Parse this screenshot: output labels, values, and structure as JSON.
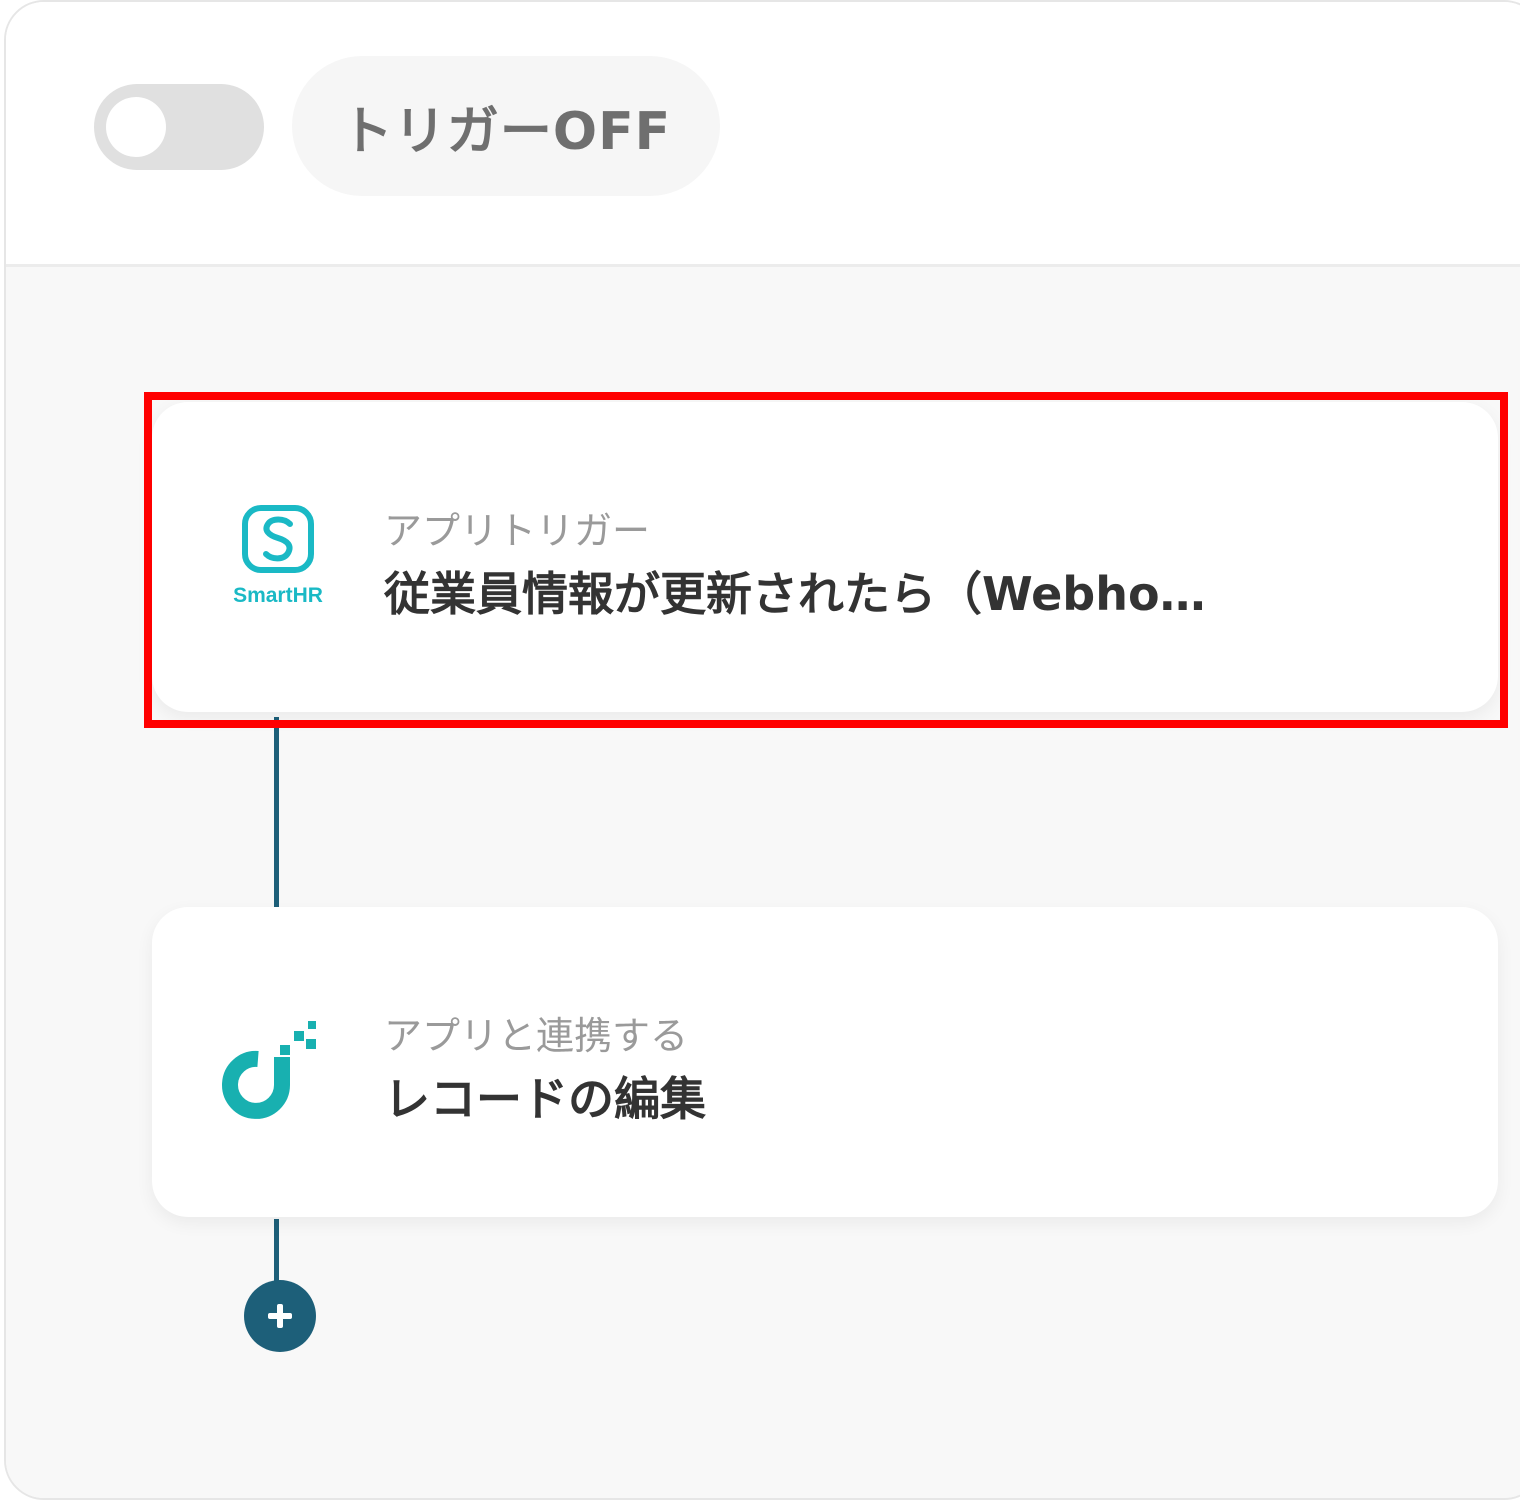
{
  "header": {
    "trigger_toggle_state": "off",
    "trigger_label": "トリガーOFF"
  },
  "flow": {
    "steps": [
      {
        "icon": "smarthr-logo-icon",
        "logo_text": "SmartHR",
        "subtitle": "アプリトリガー",
        "title": "従業員情報が更新されたら（Webho…",
        "highlighted": true
      },
      {
        "icon": "app-connect-logo-icon",
        "subtitle": "アプリと連携する",
        "title": "レコードの編集"
      }
    ],
    "add_step_icon": "plus-icon"
  },
  "colors": {
    "connector": "#1d5f79",
    "smarthr_brand": "#1ab9c5",
    "app_brand": "#18b0b0",
    "highlight": "#ff0000"
  }
}
